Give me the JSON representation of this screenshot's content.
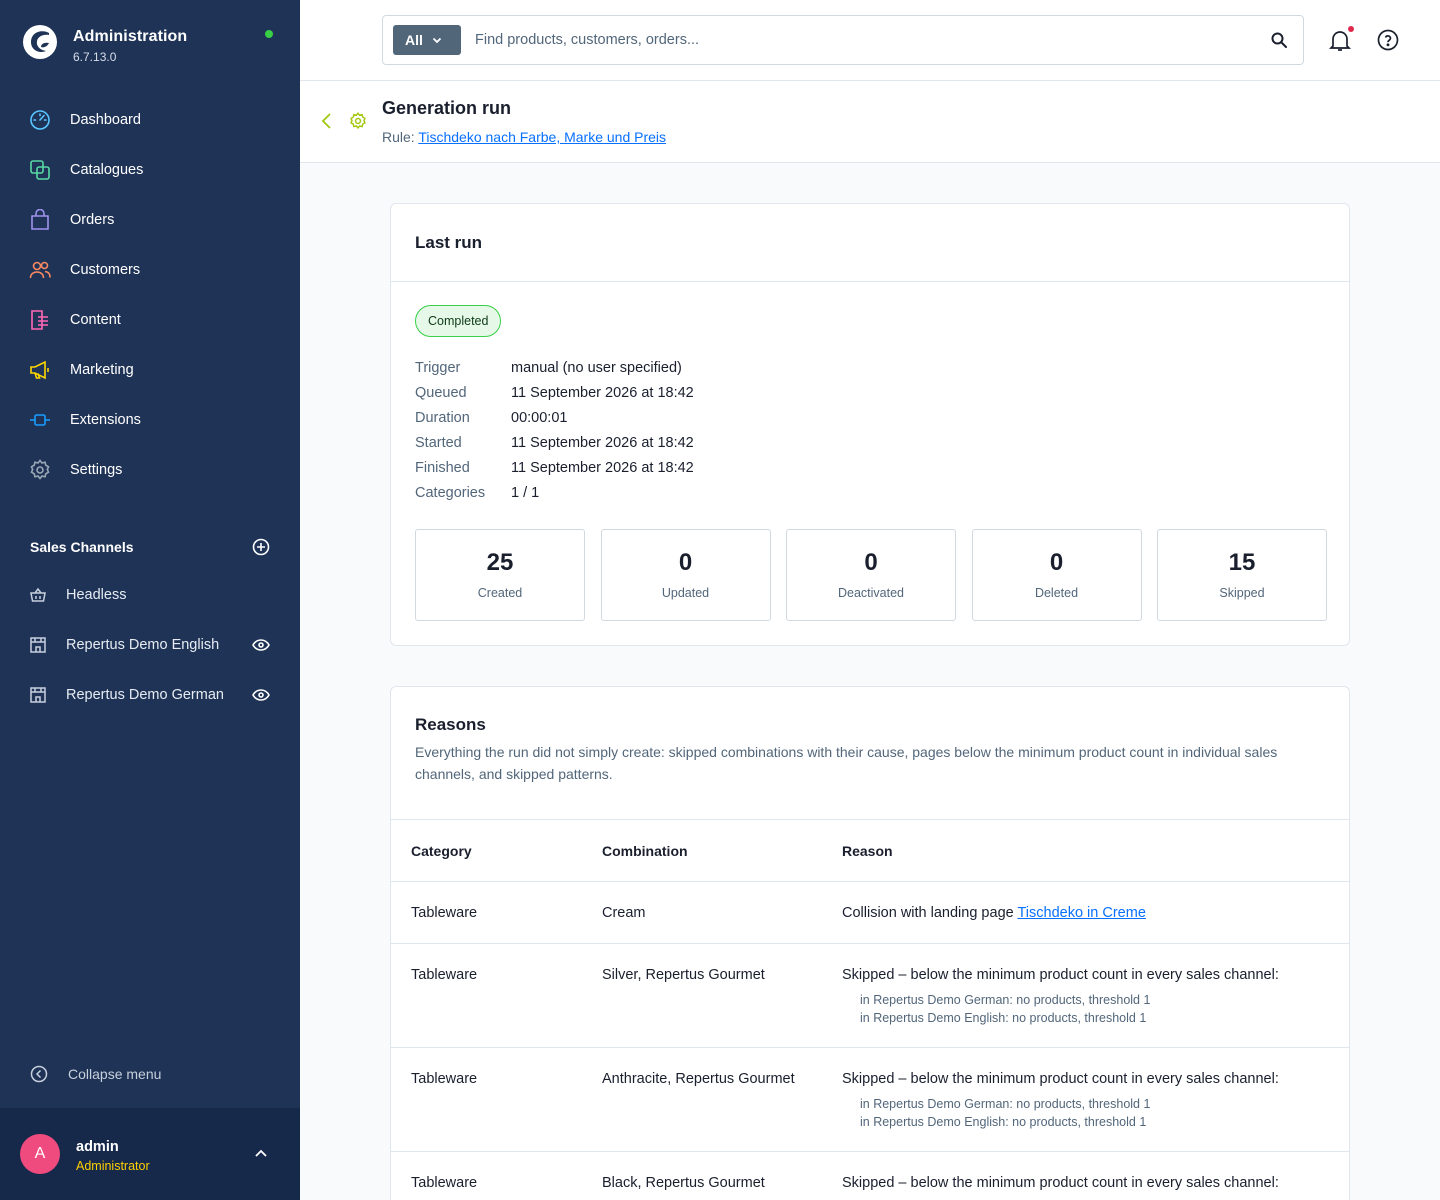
{
  "brand": {
    "title": "Administration",
    "version": "6.7.13.0"
  },
  "nav": [
    {
      "label": "Dashboard",
      "icon": "dashboard-icon",
      "color": "#58c6ff"
    },
    {
      "label": "Catalogues",
      "icon": "catalogues-icon",
      "color": "#57d9a3"
    },
    {
      "label": "Orders",
      "icon": "orders-icon",
      "color": "#a092f0"
    },
    {
      "label": "Customers",
      "icon": "customers-icon",
      "color": "#f88962"
    },
    {
      "label": "Content",
      "icon": "content-icon",
      "color": "#ff68b4"
    },
    {
      "label": "Marketing",
      "icon": "marketing-icon",
      "color": "#ffd700"
    },
    {
      "label": "Extensions",
      "icon": "extensions-icon",
      "color": "#189eff"
    },
    {
      "label": "Settings",
      "icon": "settings-icon",
      "color": "#9aa8b5"
    }
  ],
  "sales_channels": {
    "title": "Sales Channels",
    "items": [
      {
        "label": "Headless"
      },
      {
        "label": "Repertus Demo English"
      },
      {
        "label": "Repertus Demo German"
      }
    ]
  },
  "collapse_label": "Collapse menu",
  "user": {
    "initial": "A",
    "name": "admin",
    "role": "Administrator"
  },
  "search": {
    "type": "All",
    "placeholder": "Find products, customers, orders..."
  },
  "page": {
    "title": "Generation run",
    "rule_prefix": "Rule:",
    "rule_link": "Tischdeko nach Farbe, Marke und Preis"
  },
  "last_run": {
    "title": "Last run",
    "status": "Completed",
    "meta": [
      {
        "key": "Trigger",
        "value": "manual (no user specified)"
      },
      {
        "key": "Queued",
        "value": "11 September 2026 at 18:42"
      },
      {
        "key": "Duration",
        "value": "00:00:01"
      },
      {
        "key": "Started",
        "value": "11 September 2026 at 18:42"
      },
      {
        "key": "Finished",
        "value": "11 September 2026 at 18:42"
      },
      {
        "key": "Categories",
        "value": "1 / 1"
      }
    ],
    "stats": [
      {
        "value": "25",
        "label": "Created"
      },
      {
        "value": "0",
        "label": "Updated"
      },
      {
        "value": "0",
        "label": "Deactivated"
      },
      {
        "value": "0",
        "label": "Deleted"
      },
      {
        "value": "15",
        "label": "Skipped"
      }
    ]
  },
  "reasons": {
    "title": "Reasons",
    "description": "Everything the run did not simply create: skipped combinations with their cause, pages below the minimum product count in individual sales channels, and skipped patterns.",
    "columns": [
      "Category",
      "Combination",
      "Reason"
    ],
    "rows": [
      {
        "category": "Tableware",
        "combination": "Cream",
        "reason_prefix": "Collision with landing page",
        "reason_link": "Tischdeko in Creme"
      },
      {
        "category": "Tableware",
        "combination": "Silver, Repertus Gourmet",
        "reason": "Skipped – below the minimum product count in every sales channel:",
        "details": [
          "in Repertus Demo German: no products, threshold 1",
          "in Repertus Demo English: no products, threshold 1"
        ]
      },
      {
        "category": "Tableware",
        "combination": "Anthracite, Repertus Gourmet",
        "reason": "Skipped – below the minimum product count in every sales channel:",
        "details": [
          "in Repertus Demo German: no products, threshold 1",
          "in Repertus Demo English: no products, threshold 1"
        ]
      },
      {
        "category": "Tableware",
        "combination": "Black, Repertus Gourmet",
        "reason": "Skipped – below the minimum product count in every sales channel:"
      }
    ]
  }
}
